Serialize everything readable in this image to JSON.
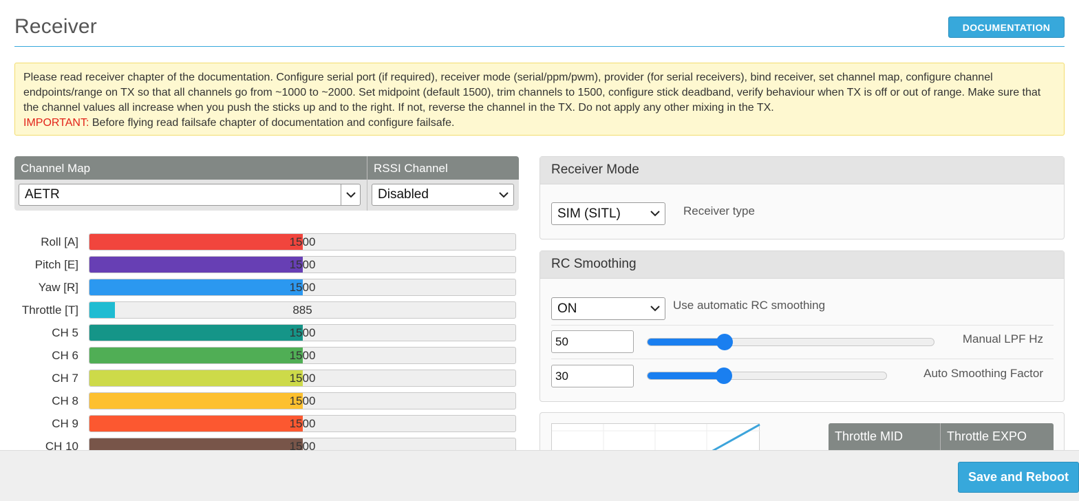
{
  "header": {
    "title": "Receiver",
    "doc_button": "DOCUMENTATION"
  },
  "note": {
    "text": "Please read receiver chapter of the documentation. Configure serial port (if required), receiver mode (serial/ppm/pwm), provider (for serial receivers), bind receiver, set channel map, configure channel endpoints/range on TX so that all channels go from ~1000 to ~2000. Set midpoint (default 1500), trim channels to 1500, configure stick deadband, verify behaviour when TX is off or out of range. Make sure that the channel values all increase when you push the sticks up and to the right. If not, reverse the channel in the TX. Do not apply any other mixing in the TX.",
    "important_label": "IMPORTANT:",
    "important_text": " Before flying read failsafe chapter of documentation and configure failsafe."
  },
  "channel_map": {
    "header_map": "Channel Map",
    "header_rssi": "RSSI Channel",
    "map_value": "AETR",
    "rssi_value": "Disabled"
  },
  "channels": [
    {
      "label": "Roll [A]",
      "value": "1500",
      "fill_fraction": 0.5,
      "color": "#f1453d"
    },
    {
      "label": "Pitch [E]",
      "value": "1500",
      "fill_fraction": 0.5,
      "color": "#673fb4"
    },
    {
      "label": "Yaw [R]",
      "value": "1500",
      "fill_fraction": 0.5,
      "color": "#2b98f0"
    },
    {
      "label": "Throttle [T]",
      "value": "885",
      "fill_fraction": 0.06,
      "color": "#1fbcd2"
    },
    {
      "label": "CH 5",
      "value": "1500",
      "fill_fraction": 0.5,
      "color": "#159588"
    },
    {
      "label": "CH 6",
      "value": "1500",
      "fill_fraction": 0.5,
      "color": "#50ae55"
    },
    {
      "label": "CH 7",
      "value": "1500",
      "fill_fraction": 0.5,
      "color": "#cdda49"
    },
    {
      "label": "CH 8",
      "value": "1500",
      "fill_fraction": 0.5,
      "color": "#fdc02f"
    },
    {
      "label": "CH 9",
      "value": "1500",
      "fill_fraction": 0.5,
      "color": "#fc5830"
    },
    {
      "label": "CH 10",
      "value": "1500",
      "fill_fraction": 0.5,
      "color": "#785549"
    }
  ],
  "receiver_mode": {
    "title": "Receiver Mode",
    "select_value": "SIM (SITL)",
    "type_label": "Receiver type"
  },
  "rc_smoothing": {
    "title": "RC Smoothing",
    "select_value": "ON",
    "select_label": "Use automatic RC smoothing",
    "lpf_value": "50",
    "lpf_label": "Manual LPF Hz",
    "lpf_slider": 0.27,
    "auto_value": "30",
    "auto_label": "Auto Smoothing Factor",
    "auto_slider": 0.32
  },
  "throttle": {
    "mid_label": "Throttle MID",
    "expo_label": "Throttle EXPO"
  },
  "footer": {
    "save_button": "Save and Reboot"
  }
}
